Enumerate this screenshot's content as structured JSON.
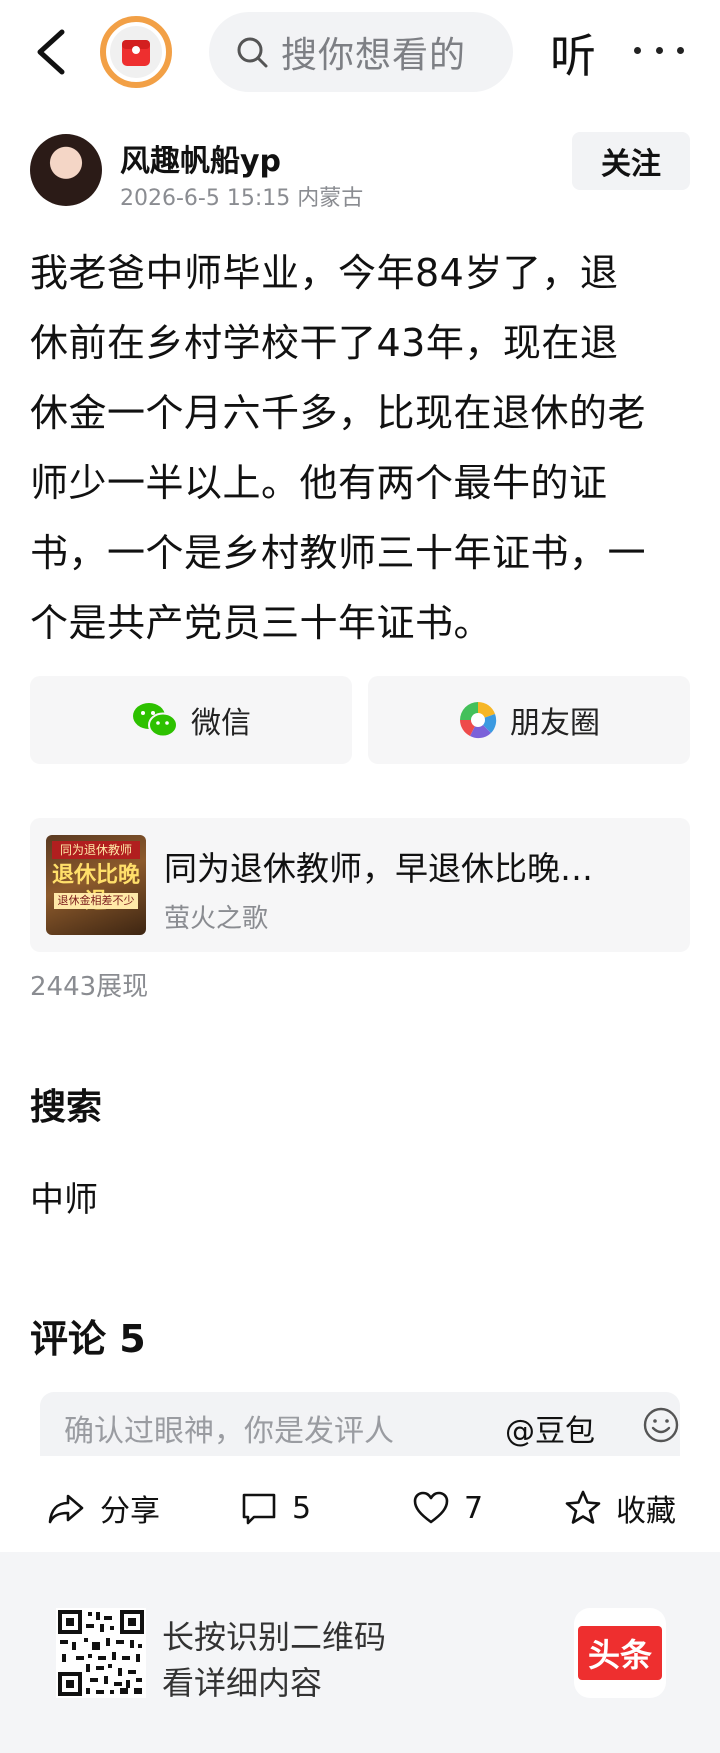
{
  "header": {
    "search_placeholder": "搜你想看的",
    "listen_label": "听"
  },
  "author": {
    "name": "风趣帆船yp",
    "meta": "2026-6-5 15:15 内蒙古",
    "follow_label": "关注"
  },
  "article": {
    "lines": [
      "我老爸中师毕业，今年84岁了，退",
      "休前在乡村学校干了43年，现在退",
      "休金一个月六千多，比现在退休的老",
      "师少一半以上。他有两个最牛的证",
      "书，一个是乡村教师三十年证书，一",
      "个是共产党员三十年证书。"
    ]
  },
  "share": {
    "wechat_label": "微信",
    "moments_label": "朋友圈"
  },
  "related": {
    "title": "同为退休教师，早退休比晚…",
    "source": "萤火之歌",
    "thumb_top": "同为退休教师",
    "thumb_main": "退休比晚退",
    "thumb_bottom": "退休金相差不少"
  },
  "stats": {
    "views": "2443展现"
  },
  "search_section": {
    "heading": "搜索",
    "tag": "中师"
  },
  "comments": {
    "heading": "评论 5",
    "input_placeholder": "确认过眼神，你是发评人",
    "mention": "@豆包"
  },
  "actions": {
    "share_label": "分享",
    "comment_count": "5",
    "like_count": "7",
    "favorite_label": "收藏"
  },
  "footer": {
    "line1": "长按识别二维码",
    "line2": "看详细内容",
    "brand": "头条"
  },
  "colors": {
    "accent_red": "#ee2f2f",
    "badge_orange": "#f2a046",
    "wechat_green": "#2dc100",
    "muted_text": "#8a8c91"
  }
}
